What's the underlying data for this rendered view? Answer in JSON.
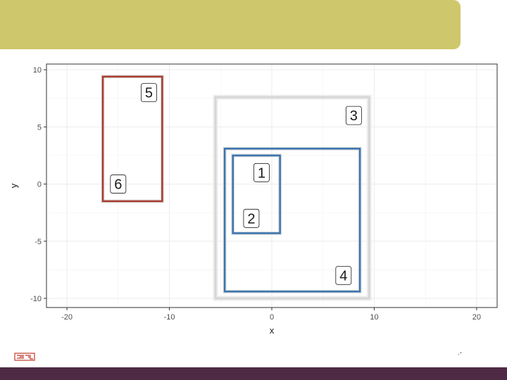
{
  "slide": {
    "header_color": "#cfc76b",
    "footer_color": "#4f2a45",
    "logo_color": "#c0392b",
    "page_number": ".-"
  },
  "chart_data": {
    "type": "rectangles",
    "xlabel": "x",
    "ylabel": "y",
    "xlim": [
      -22,
      22
    ],
    "ylim": [
      -10.8,
      10.5
    ],
    "x_ticks": [
      -20,
      -10,
      0,
      10,
      20
    ],
    "x_tick_labels": [
      "-20",
      "-10",
      "0",
      "10",
      "20"
    ],
    "y_ticks": [
      -10,
      -5,
      0,
      5,
      10
    ],
    "y_tick_labels": [
      "-10",
      "-5",
      "0",
      "5",
      "10"
    ],
    "grid": true,
    "rects": [
      {
        "label": "1",
        "xmin": -3.8,
        "xmax": 0.8,
        "ymin": -4.3,
        "ymax": 2.5,
        "color": "#3a74ae",
        "label_x": -1.0,
        "label_y": 1.0
      },
      {
        "label": "2",
        "xmin": -3.8,
        "xmax": 0.8,
        "ymin": -4.3,
        "ymax": 2.5,
        "color": "#3a74ae",
        "label_x": -2.0,
        "label_y": -3.0
      },
      {
        "label": "3",
        "xmin": -5.5,
        "xmax": 9.5,
        "ymin": -10.0,
        "ymax": 7.6,
        "color": "#d6d6d6",
        "label_x": 8.0,
        "label_y": 6.0
      },
      {
        "label": "4",
        "xmin": -4.6,
        "xmax": 8.6,
        "ymin": -9.4,
        "ymax": 3.1,
        "color": "#3a74ae",
        "label_x": 7.0,
        "label_y": -8.0
      },
      {
        "label": "5",
        "xmin": -16.5,
        "xmax": -10.7,
        "ymin": -1.5,
        "ymax": 9.4,
        "color": "#a83b2e",
        "label_x": -12.0,
        "label_y": 8.0
      },
      {
        "label": "6",
        "xmin": -16.5,
        "xmax": -10.7,
        "ymin": -1.5,
        "ymax": 9.4,
        "color": "#a83b2e",
        "label_x": -15.0,
        "label_y": 0.0
      }
    ]
  }
}
